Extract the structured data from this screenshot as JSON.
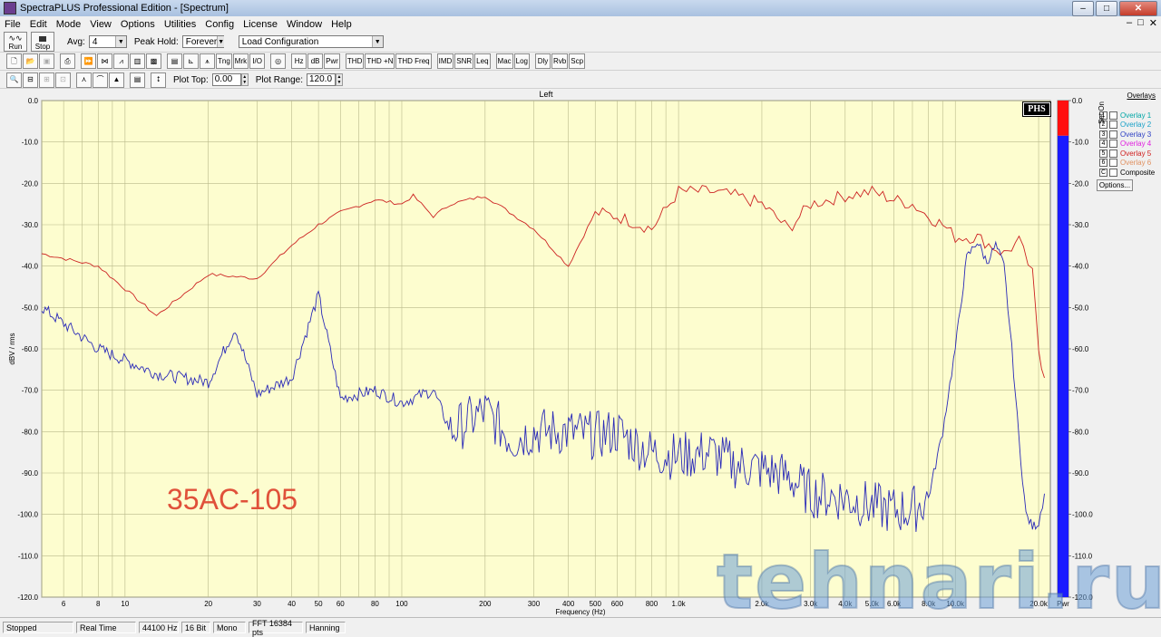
{
  "window": {
    "title": "SpectraPLUS Professional Edition - [Spectrum]",
    "min": "–",
    "max": "□",
    "close": "✕"
  },
  "menu": {
    "items": [
      "File",
      "Edit",
      "Mode",
      "View",
      "Options",
      "Utilities",
      "Config",
      "License",
      "Window",
      "Help"
    ],
    "mdi": [
      "–",
      "□",
      "✕"
    ]
  },
  "toolbar1": {
    "run": "Run",
    "stop": "Stop",
    "avg_label": "Avg:",
    "avg_value": "4",
    "peak_label": "Peak Hold:",
    "peak_value": "Forever",
    "config_value": "Load Configuration"
  },
  "toolbar2": {
    "buttons": [
      "Tng",
      "Mrk",
      "I/O",
      "Hz",
      "dB",
      "Pwr",
      "THD",
      "THD +N",
      "THD Freq",
      "IMD",
      "SNR",
      "Leq",
      "Mac",
      "Log",
      "Dly",
      "Rvb",
      "Scp"
    ]
  },
  "toolbar3": {
    "plot_top_label": "Plot Top:",
    "plot_top_value": "0.00",
    "plot_range_label": "Plot Range:",
    "plot_range_value": "120.0"
  },
  "overlays": {
    "title": "Overlays",
    "set_on": "Set On",
    "items": [
      {
        "num": "1",
        "label": "Overlay 1",
        "color": "#00a6a6"
      },
      {
        "num": "2",
        "label": "Overlay 2",
        "color": "#1aa1c8"
      },
      {
        "num": "3",
        "label": "Overlay 3",
        "color": "#2c3fc4"
      },
      {
        "num": "4",
        "label": "Overlay 4",
        "color": "#e020e0"
      },
      {
        "num": "5",
        "label": "Overlay 5",
        "color": "#d02020"
      },
      {
        "num": "6",
        "label": "Overlay 6",
        "color": "#e09060"
      },
      {
        "num": "C",
        "label": "Composite",
        "color": "#000000"
      }
    ],
    "options": "Options..."
  },
  "status": {
    "items": [
      "Stopped",
      "Real Time",
      "44100 Hz",
      "16 Bit",
      "Mono",
      "FFT 16384 pts",
      "Hanning"
    ]
  },
  "annotations": {
    "label": "35AC-105",
    "phs": "PHS",
    "watermark": "tehnari.ru"
  },
  "chart_data": {
    "type": "line",
    "title": "Left",
    "xlabel": "Frequency (Hz)",
    "ylabel": "dBV / rms",
    "xscale": "log",
    "xlim": [
      5,
      22050
    ],
    "ylim": [
      -120,
      0
    ],
    "grid": true,
    "background": "#fdfdcf",
    "xticks": [
      {
        "v": 6,
        "t": "6"
      },
      {
        "v": 8,
        "t": "8"
      },
      {
        "v": 10,
        "t": "10"
      },
      {
        "v": 20,
        "t": "20"
      },
      {
        "v": 30,
        "t": "30"
      },
      {
        "v": 40,
        "t": "40"
      },
      {
        "v": 50,
        "t": "50"
      },
      {
        "v": 60,
        "t": "60"
      },
      {
        "v": 80,
        "t": "80"
      },
      {
        "v": 100,
        "t": "100"
      },
      {
        "v": 200,
        "t": "200"
      },
      {
        "v": 300,
        "t": "300"
      },
      {
        "v": 400,
        "t": "400"
      },
      {
        "v": 500,
        "t": "500"
      },
      {
        "v": 600,
        "t": "600"
      },
      {
        "v": 800,
        "t": "800"
      },
      {
        "v": 1000,
        "t": "1.0k"
      },
      {
        "v": 2000,
        "t": "2.0k"
      },
      {
        "v": 3000,
        "t": "3.0k"
      },
      {
        "v": 4000,
        "t": "4.0k"
      },
      {
        "v": 5000,
        "t": "5.0k"
      },
      {
        "v": 6000,
        "t": "6.0k"
      },
      {
        "v": 8000,
        "t": "8.0k"
      },
      {
        "v": 10000,
        "t": "10.0k"
      },
      {
        "v": 20000,
        "t": "20.0k"
      }
    ],
    "yticks": [
      "0.0",
      "-10.0",
      "-20.0",
      "-30.0",
      "-40.0",
      "-50.0",
      "-60.0",
      "-70.0",
      "-80.0",
      "-90.0",
      "-100.0",
      "-110.0",
      "-120.0"
    ],
    "series": [
      {
        "color": "#cc2222",
        "x": [
          5,
          8,
          13,
          20,
          30,
          40,
          50,
          60,
          80,
          100,
          110,
          130,
          150,
          200,
          300,
          400,
          500,
          600,
          800,
          1000,
          1300,
          1600,
          2000,
          2500,
          3000,
          4000,
          5000,
          6000,
          7000,
          8000,
          9000,
          10000,
          12000,
          15000,
          17000,
          19000,
          20000,
          21000
        ],
        "y": [
          -37,
          -40,
          -52,
          -42,
          -43,
          -35,
          -30,
          -27,
          -24,
          -25,
          -23,
          -28,
          -25,
          -23,
          -31,
          -40,
          -27,
          -28,
          -31,
          -22,
          -22,
          -23,
          -25,
          -31,
          -25,
          -23,
          -22,
          -24,
          -25,
          -28,
          -30,
          -33,
          -33,
          -37,
          -34,
          -42,
          -60,
          -67
        ]
      },
      {
        "color": "#2a2ab8",
        "x": [
          5,
          8,
          13,
          20,
          25,
          30,
          40,
          50,
          60,
          80,
          100,
          130,
          150,
          200,
          250,
          300,
          400,
          500,
          600,
          700,
          800,
          1000,
          1300,
          1600,
          2000,
          2500,
          3000,
          4000,
          5000,
          6000,
          7000,
          8000,
          9000,
          10000,
          11000,
          12000,
          13000,
          14000,
          15000,
          16000,
          17000,
          18000,
          19000,
          20000,
          21000
        ],
        "y": [
          -50,
          -60,
          -66,
          -68,
          -55,
          -71,
          -67,
          -47,
          -72,
          -70,
          -73,
          -70,
          -80,
          -75,
          -82,
          -80,
          -80,
          -81,
          -80,
          -83,
          -85,
          -86,
          -85,
          -88,
          -89,
          -91,
          -95,
          -96,
          -98,
          -99,
          -99,
          -96,
          -80,
          -60,
          -38,
          -34,
          -39,
          -35,
          -40,
          -60,
          -82,
          -100,
          -103,
          -102,
          -95
        ]
      }
    ]
  },
  "meter": {
    "label": "Pwr",
    "ticks": [
      "0.0",
      "-10.0",
      "-20.0",
      "-30.0",
      "-40.0",
      "-50.0",
      "-60.0",
      "-70.0",
      "-80.0",
      "-90.0",
      "-100.0",
      "-110.0",
      "-120.0"
    ],
    "level_db": -8.5,
    "peak_color": "#ff1010",
    "bar_color": "#1a1aff"
  }
}
